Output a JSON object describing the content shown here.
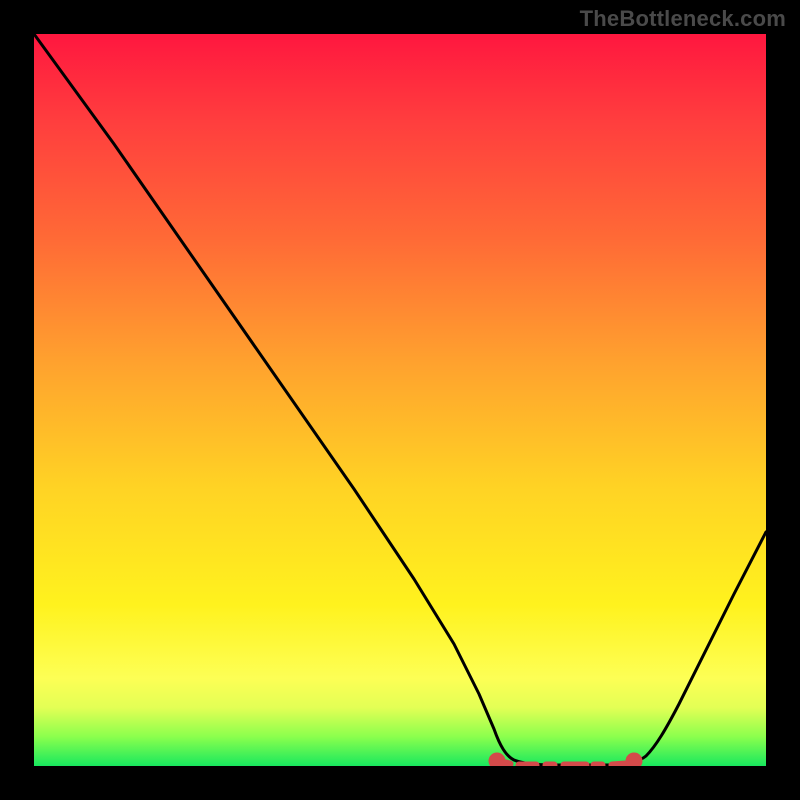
{
  "brand": "TheBottleneck.com",
  "colors": {
    "frame": "#000000",
    "line": "#000000",
    "marker": "#d44a4a",
    "gradient_top": "#ff173f",
    "gradient_bottom": "#18e85e"
  },
  "chart_data": {
    "type": "line",
    "title": "",
    "xlabel": "",
    "ylabel": "",
    "x": [
      0.0,
      0.05,
      0.1,
      0.15,
      0.2,
      0.25,
      0.3,
      0.35,
      0.4,
      0.45,
      0.5,
      0.55,
      0.6,
      0.62,
      0.65,
      0.68,
      0.7,
      0.72,
      0.75,
      0.78,
      0.8,
      0.82,
      0.85,
      0.88,
      0.91,
      0.94,
      0.97,
      1.0
    ],
    "y": [
      1.0,
      0.93,
      0.85,
      0.77,
      0.7,
      0.62,
      0.54,
      0.46,
      0.38,
      0.3,
      0.23,
      0.15,
      0.07,
      0.04,
      0.02,
      0.005,
      0.0,
      0.0,
      0.0,
      0.0,
      0.005,
      0.02,
      0.05,
      0.09,
      0.14,
      0.2,
      0.27,
      0.35
    ],
    "xlim": [
      0,
      1
    ],
    "ylim": [
      0,
      1
    ],
    "minimum_band": {
      "x_start": 0.62,
      "x_end": 0.82,
      "y": 0.0
    }
  }
}
